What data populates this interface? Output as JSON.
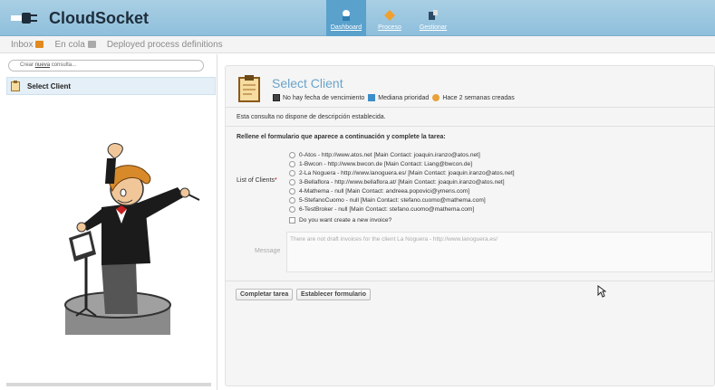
{
  "app": {
    "title": "CloudSocket",
    "icon": "plug-icon"
  },
  "topnav": [
    {
      "label": "Dashboard",
      "icon": "home-icon",
      "active": true
    },
    {
      "label": "Proceso",
      "icon": "process-icon",
      "active": false
    },
    {
      "label": "Gestionar",
      "icon": "manage-icon",
      "active": false
    }
  ],
  "subnav": {
    "inbox": "Inbox",
    "queue": "En cola",
    "deployed": "Deployed process definitions"
  },
  "search": {
    "placeholder_prefix": "Crear",
    "placeholder_link": "nueva",
    "placeholder_suffix": "consulta..."
  },
  "task_list": [
    {
      "label": "Select Client",
      "icon": "clipboard-icon"
    }
  ],
  "task": {
    "title": "Select Client",
    "due": "No hay fecha de vencimiento",
    "priority": "Mediana prioridad",
    "created": "Hace 2 semanas creadas",
    "no_description": "Esta consulta no dispone de descripción establecida.",
    "instruction": "Rellene el formulario que aparece a continuación y complete la tarea:",
    "clients_label": "List of Clients",
    "required_mark": "*",
    "clients": [
      "0-Atos - http://www.atos.net [Main Contact: joaquin.iranzo@atos.net]",
      "1-Bwcon - http://www.bwcon.de [Main Contact: Liang@bwcon.de]",
      "2-La Noguera - http://www.lanoguera.es/ [Main Contact: joaquin.iranzo@atos.net]",
      "3-Bellaflora - http://www.bellaflora.at/ [Main Contact: joaquin.iranzo@atos.net]",
      "4-Mathema - null [Main Contact: andreea.popovici@ymens.com]",
      "5-StefanoCuomo - null [Main Contact: stefano.cuomo@mathema.com]",
      "6-TestBroker - null [Main Contact: stefano.cuomo@mathema.com]"
    ],
    "invoice_checkbox": "Do you want create a new invoice?",
    "message_label": "Message",
    "message_value": "There are not draft invoices for the client La Noguera - http://www.lanoguera.es/",
    "complete_button": "Completar tarea",
    "establish_button": "Establecer formulario"
  },
  "colors": {
    "header": "#8fbfdc",
    "accent": "#6ba3c9",
    "badge": "#e28a1f"
  }
}
